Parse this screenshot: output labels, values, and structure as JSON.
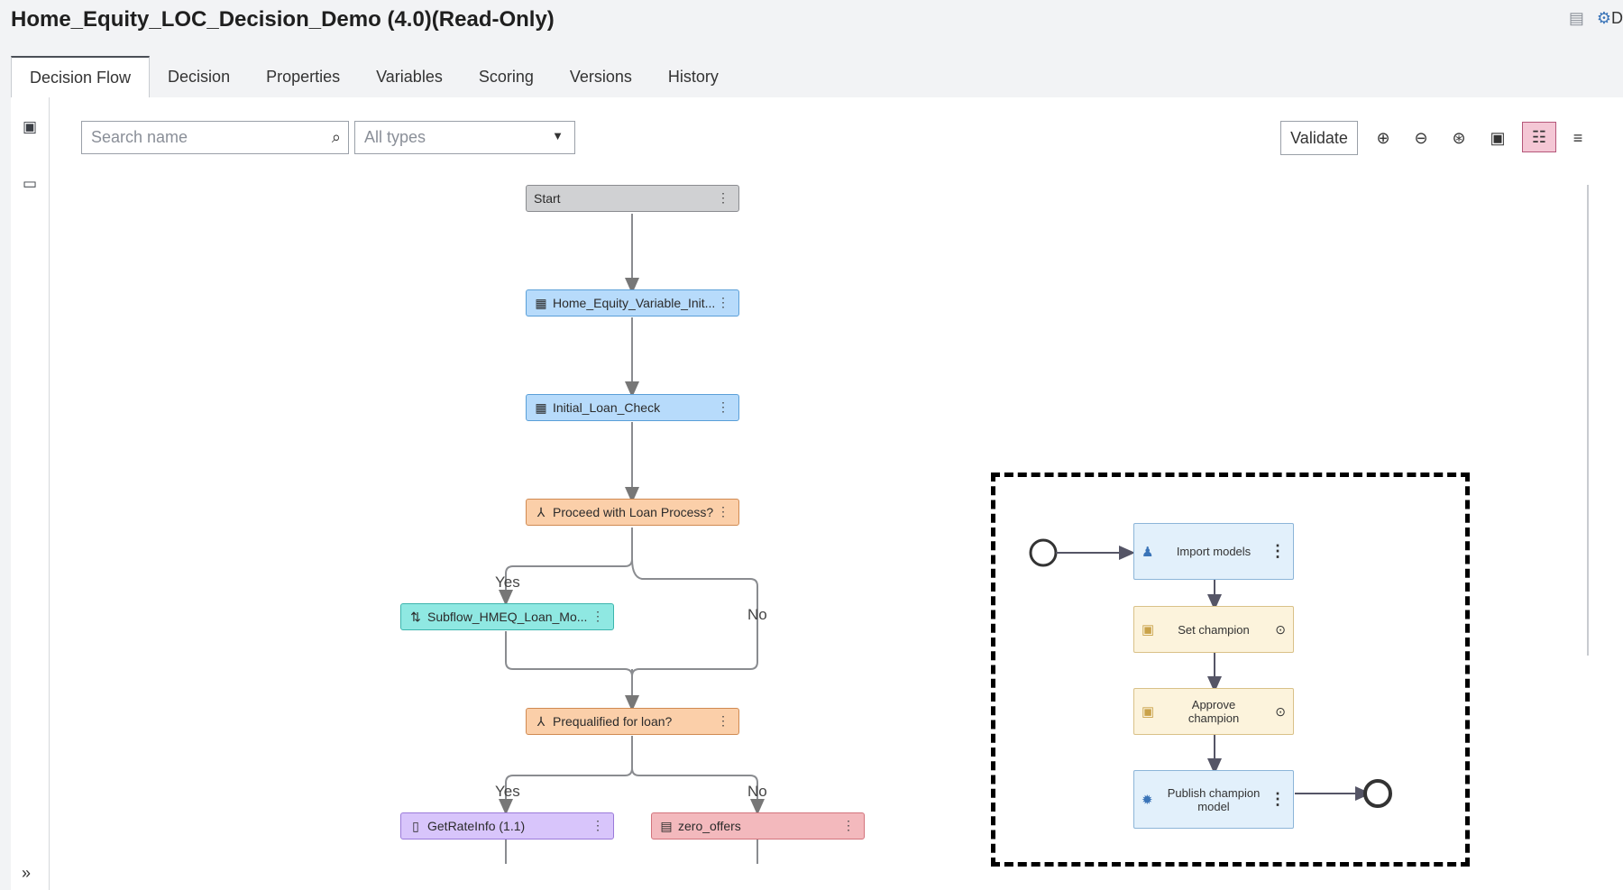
{
  "window": {
    "title": "Home_Equity_LOC_Decision_Demo (4.0)(Read-Only)",
    "right_icons": [
      "document-icon",
      "settings-icon"
    ],
    "right_text": "D"
  },
  "tabs": [
    {
      "label": "Decision Flow",
      "active": true
    },
    {
      "label": "Decision"
    },
    {
      "label": "Properties"
    },
    {
      "label": "Variables"
    },
    {
      "label": "Scoring"
    },
    {
      "label": "Versions"
    },
    {
      "label": "History"
    }
  ],
  "toolbar": {
    "search_placeholder": "Search name",
    "type_filter": "All types",
    "validate_label": "Validate",
    "tools": [
      "zoom-in-icon",
      "zoom-out-icon",
      "zoom-fit-icon",
      "fit-page-icon",
      "layout-toggle-icon",
      "wrap-icon"
    ]
  },
  "flow": {
    "nodes": {
      "start": "Start",
      "variable_init": "Home_Equity_Variable_Init...",
      "initial_check": "Initial_Loan_Check",
      "proceed": "Proceed with Loan Process?",
      "subflow": "Subflow_HMEQ_Loan_Mo...",
      "prequalified": "Prequalified for loan?",
      "rate_info": "GetRateInfo (1.1)",
      "zero_offers": "zero_offers"
    },
    "labels": {
      "yes1": "Yes",
      "no1": "No",
      "yes2": "Yes",
      "no2": "No"
    }
  },
  "inset": {
    "import": "Import models",
    "set_champion": "Set champion",
    "approve_champion": "Approve champion",
    "publish": "Publish champion model"
  },
  "colors": {
    "start": "#d0d1d3",
    "rule_set": "#b7dbfb",
    "branch": "#fbcfa9",
    "subflow": "#8fe8e2",
    "model": "#d8c5fb",
    "record": "#f3b9bd",
    "active_tool": "#f4c7d5"
  }
}
